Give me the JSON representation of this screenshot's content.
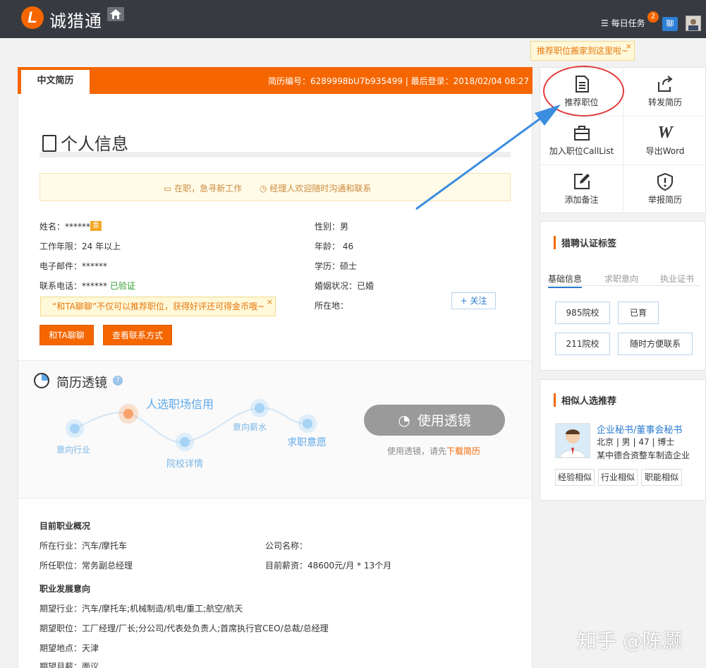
{
  "topbar": {
    "logo_mark": "L",
    "brand": "诚猎通",
    "daily_task": "每日任务",
    "task_badge": "2",
    "chat": "聊"
  },
  "tooltip_move": "推荐职位搬家到这里啦~",
  "resume": {
    "tab": "中文简历",
    "meta": "简历编号：6289998bU7b935499 | 最后登录：2018/02/04 08:27"
  },
  "personal": {
    "title": "个人信息",
    "status_1": "在职，急寻新工作",
    "status_2": "经理人欢迎随时沟通和联系",
    "left_fields": [
      {
        "text": "姓名：******"
      },
      {
        "text": "工作年限：24 年以上"
      },
      {
        "text": "电子邮件：******"
      },
      {
        "text": "联系电话：******"
      }
    ],
    "gold": "金",
    "verified": "已验证",
    "right_fields": [
      {
        "text": "性别：男"
      },
      {
        "text": "年龄： 46"
      },
      {
        "text": "学历：硕士"
      },
      {
        "text": "婚姻状况：已婚"
      },
      {
        "text": "所在地："
      }
    ],
    "chat_tip": "“和TA聊聊”不仅可以推荐职位，获得好评还可得金币哦~",
    "btn_chat": "和TA聊聊",
    "btn_contact": "查看联系方式",
    "btn_follow": "+ 关注"
  },
  "lens": {
    "title": "简历透镜",
    "help": "?",
    "labels": {
      "industry": "意向行业",
      "credit": "人选职场信用",
      "school": "院校详情",
      "salary": "意向薪水",
      "intent": "求职意愿"
    },
    "button": "使用透镜",
    "note_prefix": "使用透镜，请先",
    "note_link": "下载简历"
  },
  "career": {
    "current_title": "目前职业概况",
    "industry": "所在行业：汽车/摩托车",
    "company": "公司名称：",
    "position": "所任职位：常务副总经理",
    "salary": "目前薪资：48600元/月 * 13个月",
    "intent_title": "职业发展意向",
    "exp_industry": "期望行业：汽车/摩托车;机械制造/机电/重工;航空/航天",
    "exp_position": "期望职位：工厂经理/厂长;分公司/代表处负责人;首席执行官CEO/总裁/总经理",
    "exp_location": "期望地点：天津",
    "exp_salary": "期望月薪：面议"
  },
  "actions": [
    {
      "label": "推荐职位",
      "icon": "document-list-icon"
    },
    {
      "label": "转发简历",
      "icon": "forward-icon"
    },
    {
      "label": "加入职位CallList",
      "icon": "briefcase-icon"
    },
    {
      "label": "导出Word",
      "icon": "word-icon"
    },
    {
      "label": "添加备注",
      "icon": "edit-icon"
    },
    {
      "label": "举报简历",
      "icon": "warning-shield-icon"
    }
  ],
  "cert": {
    "title": "猎聘认证标签",
    "tabs": [
      "基础信息",
      "求职意向",
      "执业证书"
    ],
    "tags": [
      "985院校",
      "已育",
      "211院校",
      "随时方便联系"
    ]
  },
  "similar": {
    "title": "相似人选推荐",
    "name_link": "企业秘书/董事会秘书",
    "info": "北京 | 男 | 47 | 博士",
    "company": "某中德合资整车制造企业",
    "tags": [
      "经验相似",
      "行业相似",
      "职能相似"
    ]
  },
  "watermark": "知乎 @陈灏",
  "colors": {
    "brand": "#f56600",
    "topbar": "#373a40",
    "link": "#2a7bd1",
    "highlight": "#e23b3b"
  }
}
